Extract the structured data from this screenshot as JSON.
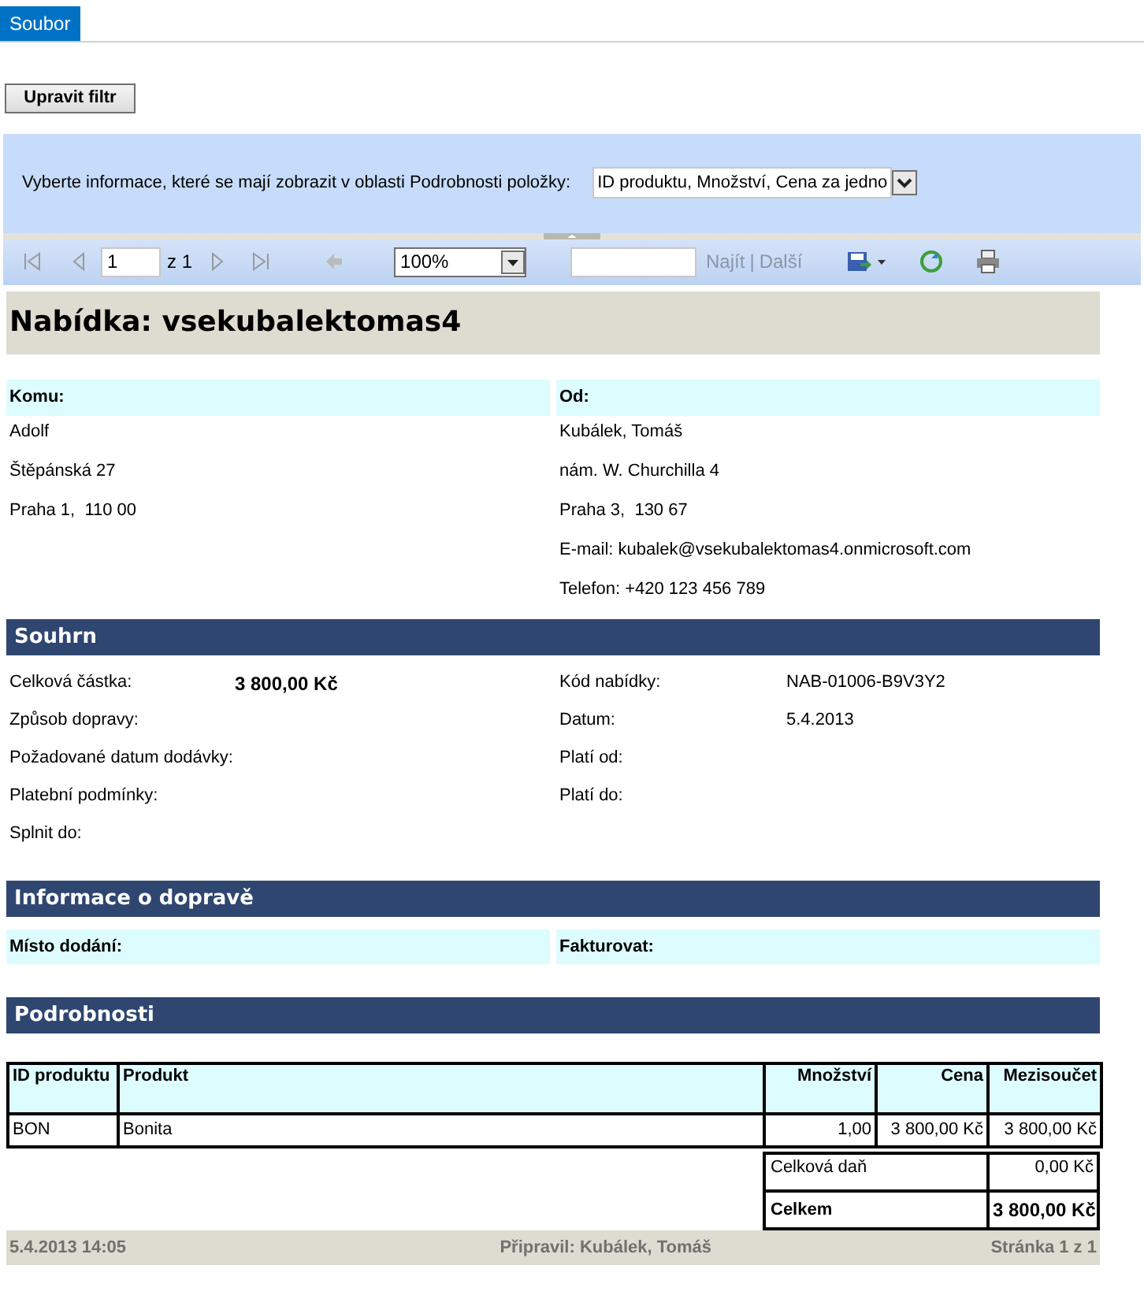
{
  "menu_tabs": [
    {
      "label": "Soubor",
      "selected": true
    }
  ],
  "filter_button": "Upravit filtr",
  "parameters": {
    "label": "Vyberte informace, které se mají zobrazit v oblasti Podrobnosti položky:",
    "value": "ID produktu, Množství, Cena za jedno"
  },
  "toolbar": {
    "page": "1",
    "page_count": "z 1",
    "zoom": "100%",
    "find_link": "Najít",
    "separator": "|",
    "next_link": "Další"
  },
  "report": {
    "title": "Nabídka: vsekubalektomas4",
    "to": {
      "heading": "Komu:",
      "lines": [
        "Adolf",
        "Štěpánská 27",
        "Praha 1,  110 00"
      ]
    },
    "from": {
      "heading": "Od:",
      "lines": [
        "Kubálek, Tomáš",
        "nám. W. Churchilla 4",
        "Praha 3,  130 67",
        "E-mail: kubalek@vsekubalektomas4.onmicrosoft.com",
        "Telefon: +420 123 456 789"
      ]
    },
    "summary": {
      "heading": "Souhrn",
      "left": [
        {
          "label": "Celková částka:",
          "value": "3 800,00 Kč"
        },
        {
          "label": "Způsob dopravy:"
        },
        {
          "label": "Požadované datum dodávky:"
        },
        {
          "label": "Platební podmínky:"
        },
        {
          "label": "Splnit do:"
        }
      ],
      "right": [
        {
          "label": "Kód nabídky:",
          "value": "NAB-01006-B9V3Y2"
        },
        {
          "label": "Datum:",
          "value": "5.4.2013"
        },
        {
          "label": "Platí od:"
        },
        {
          "label": "Platí do:"
        }
      ]
    },
    "shipping": {
      "heading": "Informace o dopravě",
      "fields": [
        "Místo dodání:",
        "Fakturovat:"
      ]
    },
    "details": {
      "heading": "Podrobnosti",
      "columns": [
        "ID produktu",
        "Produkt",
        "Množství",
        "Cena",
        "Mezisoučet"
      ],
      "rows": [
        [
          "BON",
          "Bonita",
          "1,00",
          "3 800,00 Kč",
          "3 800,00 Kč"
        ]
      ],
      "totals": [
        {
          "label": "Celková daň",
          "value": "0,00 Kč",
          "bold": false
        },
        {
          "label": "Celkem",
          "value": "3 800,00 Kč",
          "bold": true
        }
      ]
    },
    "footer": {
      "left": "5.4.2013 14:05",
      "center": "Připravil: Kubálek, Tomáš",
      "right": "Stránka 1 z 1"
    }
  }
}
